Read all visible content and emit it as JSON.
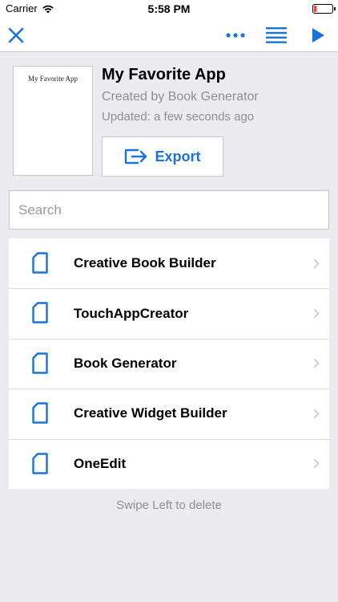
{
  "status_bar": {
    "carrier": "Carrier",
    "time": "5:58 PM"
  },
  "nav": {
    "close_icon": "close-icon",
    "more_icon": "more-icon",
    "list_icon": "list-icon",
    "play_icon": "play-icon"
  },
  "project": {
    "cover_title": "My Favorite App",
    "title": "My Favorite App",
    "creator": "Created by Book Generator",
    "updated": "Updated: a few seconds ago",
    "export_label": "Export"
  },
  "search": {
    "placeholder": "Search",
    "value": ""
  },
  "items": [
    {
      "label": "Creative Book Builder"
    },
    {
      "label": "TouchAppCreator"
    },
    {
      "label": "Book Generator"
    },
    {
      "label": "Creative Widget Builder"
    },
    {
      "label": "OneEdit"
    }
  ],
  "hint": "Swipe Left to delete",
  "colors": {
    "accent": "#1a73d9",
    "background": "#ebebf0",
    "secondary_text": "#8e8e93",
    "battery_low": "#ff3b30"
  }
}
